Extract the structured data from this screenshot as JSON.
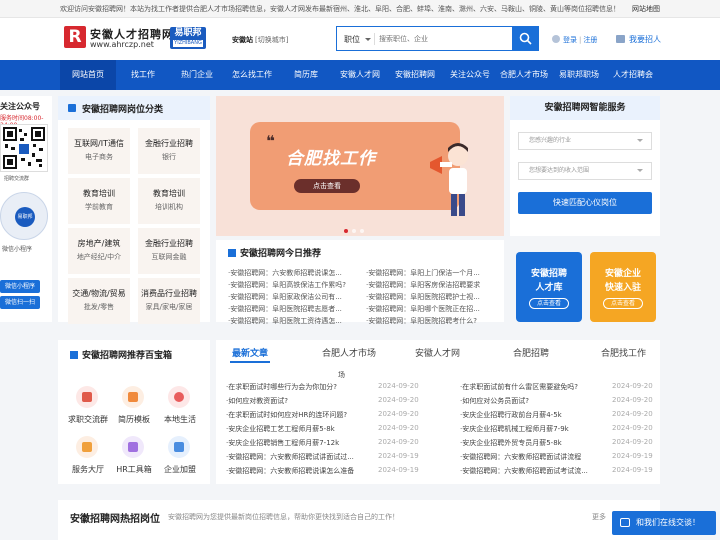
{
  "topbar": {
    "notice": "欢迎访问安徽招聘网！本站为找工作者提供合肥人才市场招聘信息，安徽人才网发布最新宿州、淮北、阜阳、合肥、蚌埠、淮南、滁州、六安、马鞍山、铜陵、黄山等岗位招聘信息！",
    "sitemap": "网站地图"
  },
  "header": {
    "logo_letter": "R",
    "logo_cn": "安徽人才招聘网",
    "logo_url": "www.ahrczp.net",
    "badge_title": "易职邦",
    "badge_sub": "YIZHIBANG",
    "city_label": "安徽站",
    "city_switch": "[切换城市]",
    "search_category": "职位",
    "search_placeholder": "搜索职位、企业",
    "login": "登录",
    "register": "注册",
    "separator": "|",
    "recruit": "我要招人"
  },
  "nav": [
    "网站首页",
    "找工作",
    "热门企业",
    "怎么找工作",
    "简历库",
    "安徽人才网",
    "安徽招聘网",
    "关注公众号",
    "合肥人才市场",
    "易职邦职场",
    "人才招聘会"
  ],
  "side": {
    "wechat_title": "关注公众号",
    "service_time": "服务时间08:00-24:00",
    "qr_caption": "招聘交流群",
    "mini_logo": "易职邦",
    "mini_caption": "微信小程序",
    "btn1": "微信小程序",
    "btn2": "微信扫一扫"
  },
  "categories": {
    "title": "安徽招聘网岗位分类",
    "items": [
      {
        "name": "互联网/IT通信",
        "desc": "电子商务"
      },
      {
        "name": "金融行业招聘",
        "desc": "银行"
      },
      {
        "name": "教育培训",
        "desc": "学前教育"
      },
      {
        "name": "教育培训",
        "desc": "培训机构"
      },
      {
        "name": "房地产/建筑",
        "desc": "地产经纪/中介"
      },
      {
        "name": "金融行业招聘",
        "desc": "互联网金融"
      },
      {
        "name": "交通/物流/贸易",
        "desc": "批发/零售"
      },
      {
        "name": "消费品行业招聘",
        "desc": "家具/家电/家居"
      }
    ]
  },
  "banner": {
    "title": "合肥找工作",
    "button": "点击查看"
  },
  "today": {
    "title": "安徽招聘网今日推荐",
    "left": [
      "·安徽招聘网：六安教师招聘说课怎...",
      "·安徽招聘网：阜阳高铁保洁工作累吗?",
      "·安徽招聘网：阜阳家政保洁公司有...",
      "·安徽招聘网：阜阳医院招聘志愿者...",
      "·安徽招聘网：阜阳医院工资待遇怎..."
    ],
    "right": [
      "·安徽招聘网：阜阳上门保洁一个月...",
      "·安徽招聘网：阜阳客房保洁招聘要求",
      "·安徽招聘网：阜阳医院招聘护士视...",
      "·安徽招聘网：阜阳哪个医院正在招...",
      "·安徽招聘网：阜阳医院招聘考什么?"
    ]
  },
  "smart": {
    "title": "安徽招聘网智能服务",
    "select1": "您感兴趣的行业",
    "select2": "您想要达到的收入范围",
    "button": "快速匹配心仪岗位"
  },
  "promo": [
    {
      "line1": "安徽招聘",
      "line2": "人才库",
      "btn": "点击查看",
      "color": "#1a6fd8"
    },
    {
      "line1": "安徽企业",
      "line2": "快速入驻",
      "btn": "点击查看",
      "color": "#f5a623"
    }
  ],
  "toolbox": {
    "title": "安徽招聘网推荐百宝箱",
    "items": [
      {
        "label": "求职交流群",
        "icon": "chat-icon",
        "bg": "#fde8e6",
        "fg": "#e05a4a"
      },
      {
        "label": "简历模板",
        "icon": "resume-icon",
        "bg": "#fdeee2",
        "fg": "#f08a3c"
      },
      {
        "label": "本地生活",
        "icon": "location-icon",
        "bg": "#fde7e7",
        "fg": "#e85c5c"
      },
      {
        "label": "服务大厅",
        "icon": "hall-icon",
        "bg": "#fdeee2",
        "fg": "#f0a03c"
      },
      {
        "label": "HR工具箱",
        "icon": "toolbox-icon",
        "bg": "#f0e8fb",
        "fg": "#a070e0"
      },
      {
        "label": "企业加盟",
        "icon": "join-icon",
        "bg": "#e6f0fd",
        "fg": "#4a8de0"
      }
    ]
  },
  "news": {
    "tabs": [
      "最新文章",
      "合肥人才市场",
      "安徽人才网",
      "合肥招聘",
      "合肥找工作"
    ],
    "tab_wrap": "场",
    "left": [
      {
        "title": "·在求职面试时哪些行为会为你加分?",
        "date": "2024-09-20"
      },
      {
        "title": "·如何应对教资面试?",
        "date": "2024-09-20"
      },
      {
        "title": "·在求职面试时如何应对HR的连环问题?",
        "date": "2024-09-20"
      },
      {
        "title": "·安庆企业招聘工艺工程师月薪5-8k",
        "date": "2024-09-20"
      },
      {
        "title": "·安庆企业招聘销售工程师月薪7-12k",
        "date": "2024-09-20"
      },
      {
        "title": "·安徽招聘网：六安教师招聘试讲面试过...",
        "date": "2024-09-19"
      },
      {
        "title": "·安徽招聘网：六安教师招聘说课怎么准备",
        "date": "2024-09-19"
      }
    ],
    "right": [
      {
        "title": "·在求职面试前有什么雷区需要避免吗?",
        "date": "2024-09-20"
      },
      {
        "title": "·如何应对公务员面试?",
        "date": "2024-09-20"
      },
      {
        "title": "·安庆企业招聘行政前台月薪4-5k",
        "date": "2024-09-20"
      },
      {
        "title": "·安庆企业招聘机械工程师月薪7-9k",
        "date": "2024-09-20"
      },
      {
        "title": "·安庆企业招聘外贸专员月薪5-8k",
        "date": "2024-09-20"
      },
      {
        "title": "·安徽招聘网：六安教师招聘面试讲流程",
        "date": "2024-09-19"
      },
      {
        "title": "·安徽招聘网：六安教师招聘面试考试流...",
        "date": "2024-09-19"
      }
    ]
  },
  "hot": {
    "title": "安徽招聘网热招岗位",
    "subtitle": "安徽招聘网为您提供最新岗位招聘信息，帮助你更快找到适合自己的工作！",
    "more": "更多"
  },
  "chat": {
    "label": "和我们在线交谈！"
  },
  "colors": {
    "nav_bg": "#1157c3",
    "accent": "#1a6fd8",
    "logo_red": "#d7282f"
  }
}
